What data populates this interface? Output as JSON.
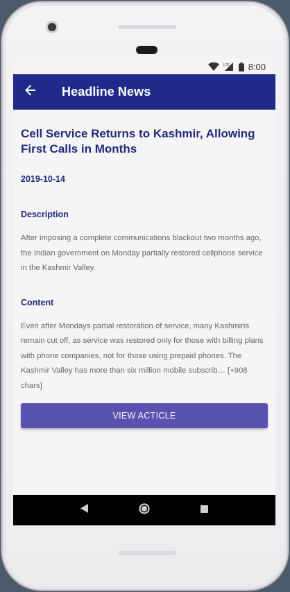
{
  "status_bar": {
    "time": "8:00",
    "icons": [
      "wifi-icon",
      "lte-signal-icon",
      "battery-icon"
    ]
  },
  "app_bar": {
    "back_icon": "arrow-left-icon",
    "title": "Headline News"
  },
  "article": {
    "headline": "Cell Service Returns to Kashmir, Allowing First Calls in Months",
    "date": "2019-10-14",
    "description_label": "Description",
    "description": "After imposing a complete communications blackout two months ago, the Indian government on Monday partially restored cellphone service in the Kashmir Valley.",
    "content_label": "Content",
    "content": "Even after Mondays partial restoration of service, many Kashmiris remain cut off, as service was restored only for those with billing plans with phone companies, not for those using prepaid phones. The Kashmir Valley has more than six million mobile subscrib… [+908 chars]",
    "button_label": "VIEW ACTICLE"
  },
  "nav_bar": {
    "icons": [
      "back-triangle-icon",
      "home-circle-icon",
      "recents-square-icon"
    ]
  },
  "colors": {
    "app_bar": "#1f2a8b",
    "accent_text": "#1f2a7a",
    "button": "#5a52b1"
  }
}
